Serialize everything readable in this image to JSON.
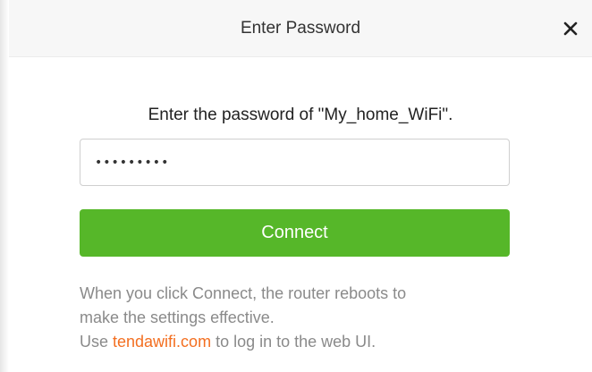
{
  "dialog": {
    "title": "Enter Password",
    "close_icon": "close-icon"
  },
  "prompt": "Enter the password of \"My_home_WiFi\".",
  "password_field": {
    "value": "•••••••••"
  },
  "connect_button": {
    "label": "Connect"
  },
  "note": {
    "line1": "When you click Connect, the router reboots to",
    "line2": "make the settings effective.",
    "line3_prefix": "Use ",
    "link_text": "tendawifi.com",
    "line3_suffix": " to log in to the web UI."
  },
  "colors": {
    "button": "#56b729",
    "link": "#f36f21",
    "note_text": "#8a8a8a"
  }
}
